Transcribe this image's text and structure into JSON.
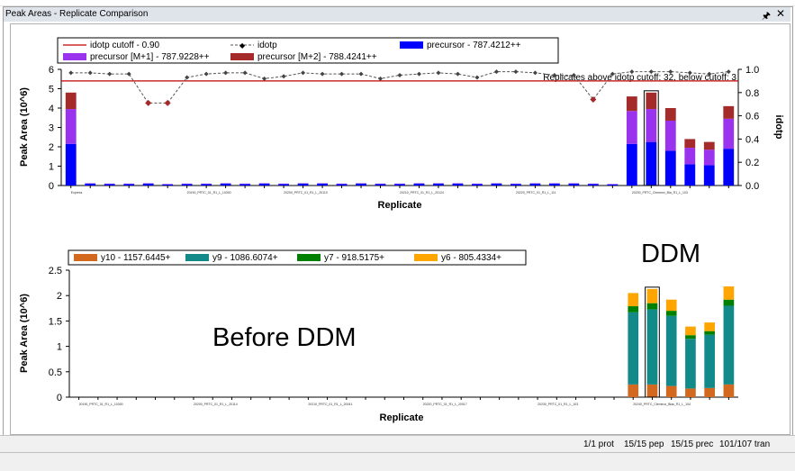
{
  "window": {
    "title": "Peak Areas - Replicate Comparison",
    "pin_icon": "pin-icon",
    "close_icon": "close-icon"
  },
  "colors": {
    "idotp_cutoff": "#c00000",
    "idotp": "#555555",
    "precursor": "#0000ff",
    "precursor_m1": "#9933ee",
    "precursor_m2": "#a52a2a",
    "y10": "#d2691e",
    "y9": "#138a8a",
    "y7": "#008000",
    "y6": "#ffa500"
  },
  "chart_data": [
    {
      "type": "bar",
      "title": "",
      "xlabel": "Replicate",
      "ylabel": "Peak Area (10^6)",
      "y2label": "idotp",
      "ylim": [
        0,
        6
      ],
      "y2lim": [
        0,
        1.0
      ],
      "yticks": [
        "0",
        "1",
        "2",
        "3",
        "4",
        "5",
        "6"
      ],
      "y2ticks": [
        "0.0",
        "0.2",
        "0.4",
        "0.6",
        "0.8",
        "1.0"
      ],
      "annotation": "Replicates above idotp cutoff: 32, below cutoff: 3",
      "legend": [
        {
          "label": "idotp cutoff - 0.90",
          "kind": "line"
        },
        {
          "label": "idotp",
          "kind": "dashline"
        },
        {
          "label": "precursor - 787.4212++",
          "kind": "box"
        },
        {
          "label": "precursor [M+1] - 787.9228++",
          "kind": "box"
        },
        {
          "label": "precursor [M+2] - 788.4241++",
          "kind": "box"
        }
      ],
      "n_replicates": 35,
      "cutoff": 0.9,
      "series": [
        {
          "name": "precursor - 787.4212++",
          "values": [
            2.15,
            0.1,
            0.08,
            0.08,
            0.1,
            0.06,
            0.08,
            0.08,
            0.1,
            0.08,
            0.1,
            0.08,
            0.1,
            0.1,
            0.08,
            0.1,
            0.08,
            0.08,
            0.1,
            0.1,
            0.1,
            0.08,
            0.1,
            0.08,
            0.1,
            0.1,
            0.1,
            0.08,
            0.06,
            2.15,
            2.25,
            1.8,
            1.1,
            1.05,
            1.9
          ]
        },
        {
          "name": "precursor [M+1] - 787.9228++",
          "values": [
            1.8,
            0.02,
            0.02,
            0.02,
            0.02,
            0.02,
            0.02,
            0.02,
            0.02,
            0.02,
            0.02,
            0.02,
            0.02,
            0.02,
            0.02,
            0.02,
            0.02,
            0.02,
            0.02,
            0.02,
            0.02,
            0.02,
            0.02,
            0.02,
            0.02,
            0.02,
            0.02,
            0.02,
            0.02,
            1.7,
            1.7,
            1.55,
            0.85,
            0.8,
            1.55
          ]
        },
        {
          "name": "precursor [M+2] - 788.4241++",
          "values": [
            0.85,
            0.0,
            0.0,
            0.0,
            0.0,
            0.0,
            0.0,
            0.0,
            0.0,
            0.0,
            0.0,
            0.0,
            0.0,
            0.0,
            0.0,
            0.0,
            0.0,
            0.0,
            0.0,
            0.0,
            0.0,
            0.0,
            0.0,
            0.0,
            0.0,
            0.0,
            0.0,
            0.0,
            0.0,
            0.75,
            0.85,
            0.65,
            0.45,
            0.4,
            0.65
          ]
        }
      ],
      "idotp": [
        0.97,
        0.97,
        0.96,
        0.96,
        0.71,
        0.71,
        0.93,
        0.96,
        0.97,
        0.97,
        0.92,
        0.94,
        0.97,
        0.96,
        0.96,
        0.96,
        0.92,
        0.95,
        0.96,
        0.97,
        0.96,
        0.93,
        0.98,
        0.98,
        0.97,
        0.95,
        0.95,
        0.74,
        0.96,
        0.98,
        0.98,
        0.98,
        0.97,
        0.96,
        0.98
      ],
      "x_tick_labels": [
        "Express",
        "20190_PRTC_01_R1_L_10300",
        "20200_PRTC_01_R1_L_20110",
        "20210_PRTC_01_R1_L_20124",
        "20220_PRTC_01_R1_L_111",
        "20230_PRTC_Clemeux_Bla_R1_L_103"
      ]
    },
    {
      "type": "bar",
      "title": "",
      "xlabel": "Replicate",
      "ylabel": "Peak Area (10^6)",
      "ylim": [
        0,
        2.5
      ],
      "yticks": [
        "0",
        "0.5",
        "1",
        "1.5",
        "2",
        "2.5"
      ],
      "legend": [
        {
          "label": "y10 - 1157.6445+",
          "kind": "box"
        },
        {
          "label": "y9 - 1086.6074+",
          "kind": "box"
        },
        {
          "label": "y7 - 918.5175+",
          "kind": "box"
        },
        {
          "label": "y6 - 805.4334+",
          "kind": "box"
        }
      ],
      "n_replicates": 35,
      "series": [
        {
          "name": "y10 - 1157.6445+",
          "values": [
            0,
            0,
            0,
            0,
            0,
            0,
            0,
            0,
            0,
            0,
            0,
            0,
            0,
            0,
            0,
            0,
            0,
            0,
            0,
            0,
            0,
            0,
            0,
            0,
            0,
            0,
            0,
            0,
            0,
            0.25,
            0.25,
            0.22,
            0.17,
            0.18,
            0.25
          ]
        },
        {
          "name": "y9 - 1086.6074+",
          "values": [
            0,
            0,
            0,
            0,
            0,
            0,
            0,
            0,
            0,
            0,
            0,
            0,
            0,
            0,
            0,
            0,
            0,
            0,
            0,
            0,
            0,
            0,
            0,
            0,
            0,
            0,
            0,
            0,
            0,
            1.42,
            1.48,
            1.38,
            0.98,
            1.05,
            1.55
          ]
        },
        {
          "name": "y7 - 918.5175+",
          "values": [
            0,
            0,
            0,
            0,
            0,
            0,
            0,
            0,
            0,
            0,
            0,
            0,
            0,
            0,
            0,
            0,
            0,
            0,
            0,
            0,
            0,
            0,
            0,
            0,
            0,
            0,
            0,
            0,
            0,
            0.12,
            0.12,
            0.1,
            0.07,
            0.07,
            0.12
          ]
        },
        {
          "name": "y6 - 805.4334+",
          "values": [
            0,
            0,
            0,
            0,
            0,
            0,
            0,
            0,
            0,
            0,
            0,
            0,
            0,
            0,
            0,
            0,
            0,
            0,
            0,
            0,
            0,
            0,
            0,
            0,
            0,
            0,
            0,
            0,
            0,
            0.26,
            0.28,
            0.22,
            0.17,
            0.17,
            0.26
          ]
        }
      ],
      "x_tick_labels": [
        "20190_PRTC_01_R1_L_10300",
        "20200_PRTC_01_R1_L_20114",
        "20210_PRTC_01_R1_L_20041",
        "20220_PRTC_01_R1_L_20017",
        "20230_PRTC_01_R1_L_103",
        "20240_PRTC_Clemeux_Blas_R1_L_104"
      ]
    }
  ],
  "overlays": {
    "before": "Before DDM",
    "ddm": "DDM"
  },
  "status": {
    "prot": "1/1 prot",
    "pep": "15/15 pep",
    "prec": "15/15 prec",
    "tran": "101/107 tran"
  }
}
